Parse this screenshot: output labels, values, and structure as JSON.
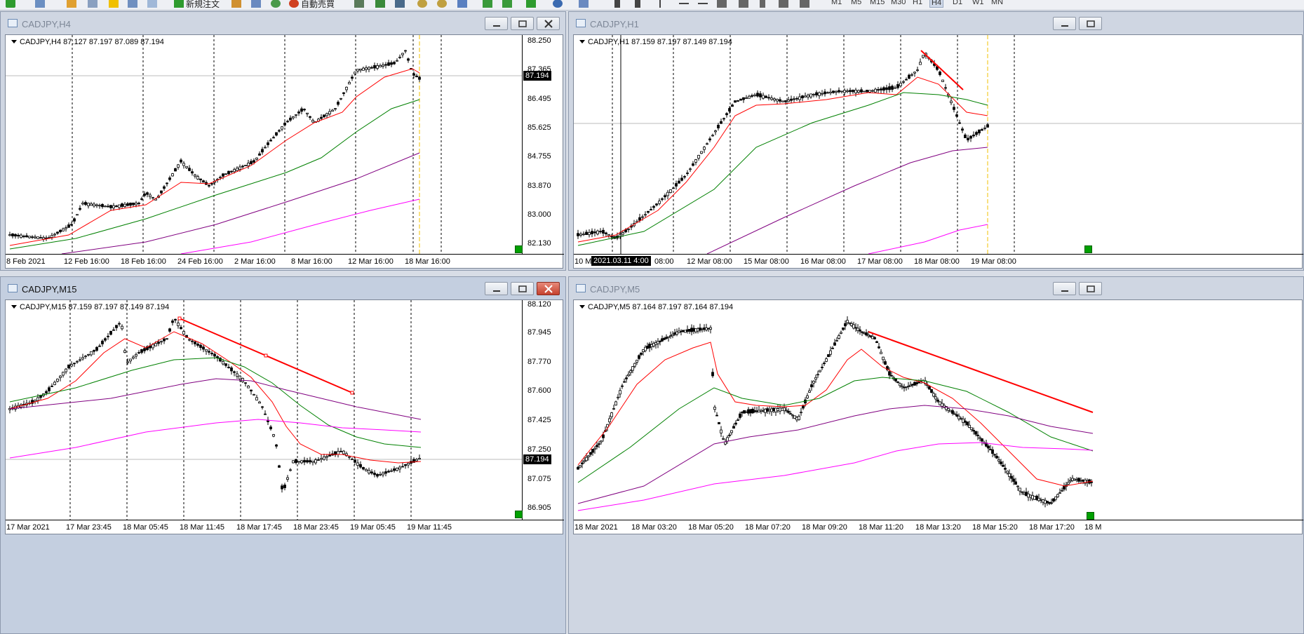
{
  "toolbar": {
    "new_order_label": "新規注文",
    "auto_trade_label": "自動売買",
    "timeframes": [
      "M1",
      "M5",
      "M15",
      "M30",
      "H1",
      "H4",
      "D1",
      "W1",
      "MN"
    ],
    "active_timeframe": "H4"
  },
  "windows": [
    {
      "id": "h4",
      "title": "CADJPY,H4",
      "active": false,
      "header": "CADJPY,H4  87.127 87.197 87.089 87.194",
      "price_tag": "87.194",
      "ytick_labels": [
        "88.250",
        "87.365",
        "86.495",
        "85.625",
        "84.755",
        "83.870",
        "83.000",
        "82.130"
      ],
      "xtick_labels": [
        "8 Feb 2021",
        "12 Feb 16:00",
        "18 Feb 16:00",
        "24 Feb 16:00",
        "2 Mar 16:00",
        "8 Mar 16:00",
        "12 Mar 16:00",
        "18 Mar 16:00"
      ]
    },
    {
      "id": "h1",
      "title": "CADJPY,H1",
      "active": false,
      "header": "CADJPY,H1  87.159 87.197 87.149 87.194",
      "date_tag": "2021.03.11 4:00",
      "xtick_labels": [
        "10 M",
        "08:00",
        "12 Mar 08:00",
        "15 Mar 08:00",
        "16 Mar 08:00",
        "17 Mar 08:00",
        "18 Mar 08:00",
        "19 Mar 08:00"
      ]
    },
    {
      "id": "m15",
      "title": "CADJPY,M15",
      "active": true,
      "header": "CADJPY,M15  87.159 87.197 87.149 87.194",
      "price_tag": "87.194",
      "ytick_labels": [
        "88.120",
        "87.945",
        "87.770",
        "87.600",
        "87.425",
        "87.250",
        "87.075",
        "86.905"
      ],
      "xtick_labels": [
        "17 Mar 2021",
        "17 Mar 23:45",
        "18 Mar 05:45",
        "18 Mar 11:45",
        "18 Mar 17:45",
        "18 Mar 23:45",
        "19 Mar 05:45",
        "19 Mar 11:45"
      ]
    },
    {
      "id": "m5",
      "title": "CADJPY,M5",
      "active": false,
      "header": "CADJPY,M5  87.164 87.197 87.164 87.194",
      "xtick_labels": [
        "18 Mar 2021",
        "18 Mar 03:20",
        "18 Mar 05:20",
        "18 Mar 07:20",
        "18 Mar 09:20",
        "18 Mar 11:20",
        "18 Mar 13:20",
        "18 Mar 15:20",
        "18 Mar 17:20",
        "18 M"
      ]
    }
  ],
  "colors": {
    "ma_fast": "#ff0000",
    "ma_mid": "#008000",
    "ma_slow": "#800080",
    "ma_long": "#ff00ff",
    "trendline": "#ff0000"
  }
}
